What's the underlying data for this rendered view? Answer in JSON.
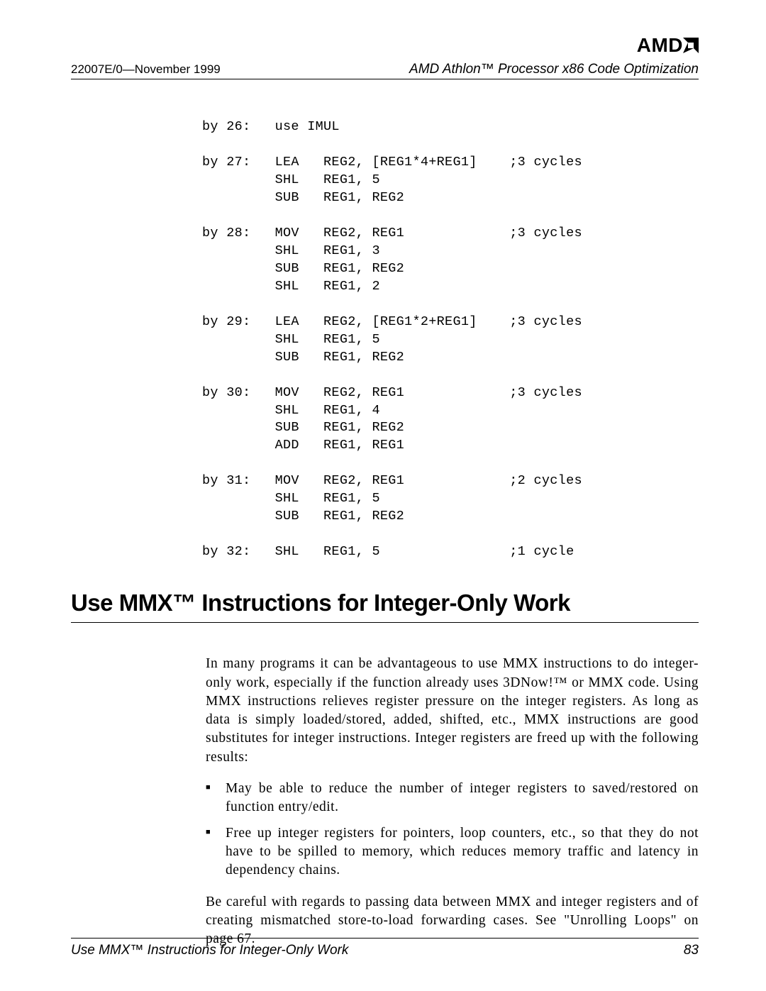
{
  "header": {
    "docnum": "22007E/0—November 1999",
    "title": "AMD Athlon™ Processor x86 Code Optimization",
    "logo_text": "AMD"
  },
  "code": "by 26:   use IMUL\n\nby 27:   LEA   REG2, [REG1*4+REG1]    ;3 cycles\n         SHL   REG1, 5\n         SUB   REG1, REG2\n\nby 28:   MOV   REG2, REG1             ;3 cycles\n         SHL   REG1, 3\n         SUB   REG1, REG2\n         SHL   REG1, 2\n\nby 29:   LEA   REG2, [REG1*2+REG1]    ;3 cycles\n         SHL   REG1, 5\n         SUB   REG1, REG2\n\nby 30:   MOV   REG2, REG1             ;3 cycles\n         SHL   REG1, 4\n         SUB   REG1, REG2\n         ADD   REG1, REG1\n\nby 31:   MOV   REG2, REG1             ;2 cycles\n         SHL   REG1, 5\n         SUB   REG1, REG2\n\nby 32:   SHL   REG1, 5                ;1 cycle",
  "section_heading": "Use MMX™ Instructions for Integer-Only Work",
  "body": {
    "para1": "In many programs it can be advantageous to use MMX instructions to do integer-only work, especially if the function already uses 3DNow!™ or MMX code. Using MMX instructions relieves register pressure on the integer registers. As long as data is simply loaded/stored, added, shifted, etc., MMX instructions are good substitutes for integer instructions. Integer registers are freed up with the following results:",
    "bullets": [
      "May be able to reduce the number of integer registers to saved/restored on function entry/edit.",
      "Free up integer registers for pointers, loop counters, etc., so that they do not have to be spilled to memory, which reduces memory traffic and latency in dependency chains."
    ],
    "para2": "Be careful with regards to passing data between MMX and integer registers and of creating mismatched store-to-load forwarding cases. See \"Unrolling Loops\" on page 67."
  },
  "footer": {
    "left": "Use MMX™ Instructions for Integer-Only Work",
    "pagenum": "83"
  }
}
